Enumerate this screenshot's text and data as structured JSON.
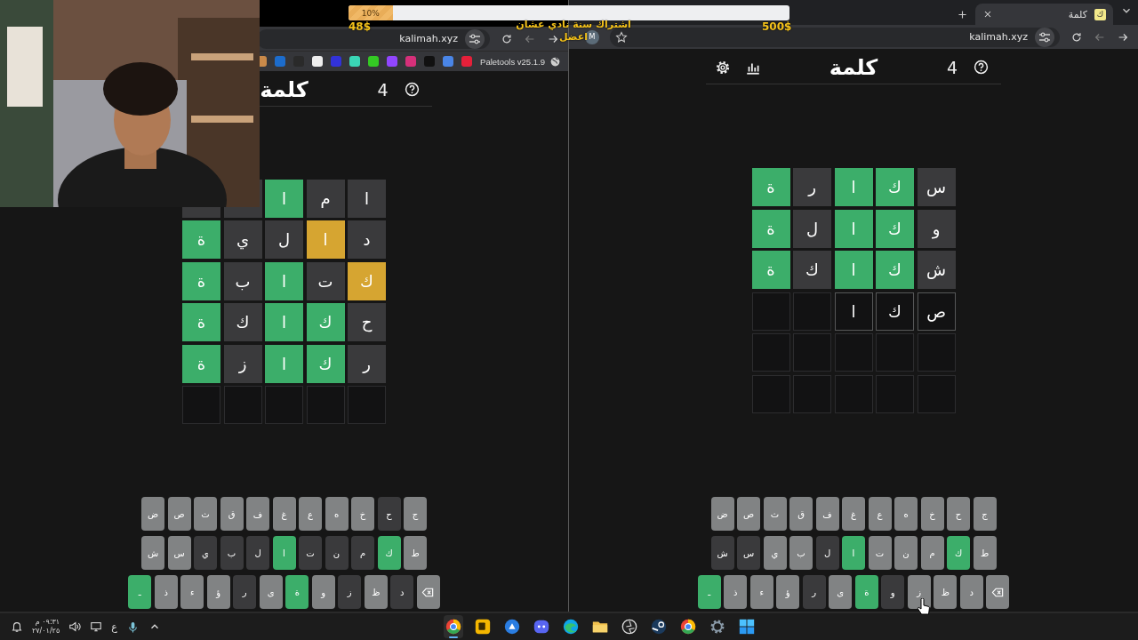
{
  "stream_goal": {
    "label": "10%",
    "level": 0.1,
    "raised": "48$",
    "target": "500$",
    "caption": [
      "اشتراك سنة نادي عشان",
      "اعضل"
    ]
  },
  "windows": [
    {
      "tab_strip": {
        "tabs": [
          {
            "title": "كلمة",
            "favicon": "ك",
            "selected": true
          }
        ]
      },
      "toolbar": {
        "url": "kalimah.xyz",
        "profile": "M",
        "nav": [
          {
            "kind": "forward",
            "disabled": false
          },
          {
            "kind": "back",
            "disabled": true
          },
          {
            "kind": "reload",
            "disabled": false
          }
        ]
      },
      "board": {
        "header": {
          "title": "كلمة",
          "count": "4",
          "tools": [
            {
              "kind": "stats"
            },
            {
              "kind": "settings"
            }
          ]
        },
        "rows": [
          [
            {
              "kind": "scored",
              "letter": "س",
              "color": "#3a3a3c"
            },
            {
              "kind": "scored",
              "letter": "ك",
              "color": "#3cae6a"
            },
            {
              "kind": "scored",
              "letter": "ا",
              "color": "#3cae6a"
            },
            {
              "kind": "scored",
              "letter": "ر",
              "color": "#3a3a3c"
            },
            {
              "kind": "scored",
              "letter": "ة",
              "color": "#3cae6a"
            }
          ],
          [
            {
              "kind": "scored",
              "letter": "و",
              "color": "#3a3a3c"
            },
            {
              "kind": "scored",
              "letter": "ك",
              "color": "#3cae6a"
            },
            {
              "kind": "scored",
              "letter": "ا",
              "color": "#3cae6a"
            },
            {
              "kind": "scored",
              "letter": "ل",
              "color": "#3a3a3c"
            },
            {
              "kind": "scored",
              "letter": "ة",
              "color": "#3cae6a"
            }
          ],
          [
            {
              "kind": "scored",
              "letter": "ش",
              "color": "#3a3a3c"
            },
            {
              "kind": "scored",
              "letter": "ك",
              "color": "#3cae6a"
            },
            {
              "kind": "scored",
              "letter": "ا",
              "color": "#3cae6a"
            },
            {
              "kind": "scored",
              "letter": "ك",
              "color": "#3a3a3c"
            },
            {
              "kind": "scored",
              "letter": "ة",
              "color": "#3cae6a"
            }
          ],
          [
            {
              "kind": "typed",
              "letter": "ص"
            },
            {
              "kind": "typed",
              "letter": "ك"
            },
            {
              "kind": "typed",
              "letter": "ا"
            },
            {
              "kind": "empty"
            },
            {
              "kind": "empty"
            }
          ],
          [
            {
              "kind": "empty"
            },
            {
              "kind": "empty"
            },
            {
              "kind": "empty"
            },
            {
              "kind": "empty"
            },
            {
              "kind": "empty"
            }
          ],
          [
            {
              "kind": "empty"
            },
            {
              "kind": "empty"
            },
            {
              "kind": "empty"
            },
            {
              "kind": "empty"
            },
            {
              "kind": "empty"
            }
          ]
        ],
        "keyboard": [
          [
            {
              "kind": "letter",
              "label": "ج",
              "color": "#818384"
            },
            {
              "kind": "letter",
              "label": "ح",
              "color": "#818384"
            },
            {
              "kind": "letter",
              "label": "خ",
              "color": "#818384"
            },
            {
              "kind": "letter",
              "label": "ه",
              "color": "#818384"
            },
            {
              "kind": "letter",
              "label": "ع",
              "color": "#818384"
            },
            {
              "kind": "letter",
              "label": "غ",
              "color": "#818384"
            },
            {
              "kind": "letter",
              "label": "ف",
              "color": "#818384"
            },
            {
              "kind": "letter",
              "label": "ق",
              "color": "#818384"
            },
            {
              "kind": "letter",
              "label": "ث",
              "color": "#818384"
            },
            {
              "kind": "letter",
              "label": "ص",
              "color": "#818384"
            },
            {
              "kind": "letter",
              "label": "ض",
              "color": "#818384"
            }
          ],
          [
            {
              "kind": "letter",
              "label": "ط",
              "color": "#818384"
            },
            {
              "kind": "letter",
              "label": "ك",
              "color": "#3cae6a"
            },
            {
              "kind": "letter",
              "label": "م",
              "color": "#818384"
            },
            {
              "kind": "letter",
              "label": "ن",
              "color": "#818384"
            },
            {
              "kind": "letter",
              "label": "ت",
              "color": "#818384"
            },
            {
              "kind": "letter",
              "label": "ا",
              "color": "#3cae6a"
            },
            {
              "kind": "letter",
              "label": "ل",
              "color": "#3a3a3c"
            },
            {
              "kind": "letter",
              "label": "ب",
              "color": "#818384"
            },
            {
              "kind": "letter",
              "label": "ي",
              "color": "#818384"
            },
            {
              "kind": "letter",
              "label": "س",
              "color": "#3a3a3c"
            },
            {
              "kind": "letter",
              "label": "ش",
              "color": "#3a3a3c"
            }
          ],
          [
            {
              "kind": "backspace",
              "color": "#818384"
            },
            {
              "kind": "letter",
              "label": "د",
              "color": "#818384"
            },
            {
              "kind": "letter",
              "label": "ظ",
              "color": "#818384"
            },
            {
              "kind": "letter",
              "label": "ز",
              "color": "#818384"
            },
            {
              "kind": "letter",
              "label": "و",
              "color": "#3a3a3c"
            },
            {
              "kind": "letter",
              "label": "ة",
              "color": "#3cae6a"
            },
            {
              "kind": "letter",
              "label": "ى",
              "color": "#818384"
            },
            {
              "kind": "letter",
              "label": "ر",
              "color": "#3a3a3c"
            },
            {
              "kind": "letter",
              "label": "ؤ",
              "color": "#818384"
            },
            {
              "kind": "letter",
              "label": "ء",
              "color": "#818384"
            },
            {
              "kind": "letter",
              "label": "ذ",
              "color": "#818384"
            },
            {
              "kind": "enter",
              "label": "ـ",
              "color": "#3cae6a"
            }
          ]
        ]
      }
    },
    {
      "toolbar": {
        "url": "kalimah.xyz",
        "nav": [
          {
            "kind": "forward",
            "disabled": false
          },
          {
            "kind": "back",
            "disabled": true
          },
          {
            "kind": "reload",
            "disabled": false
          }
        ]
      },
      "bookmarks": [
        {
          "kind": "globe",
          "label": "Paletools v25.1.9"
        },
        {
          "kind": "site",
          "color": "#e5203a"
        },
        {
          "kind": "site",
          "color": "#4a86e8"
        },
        {
          "kind": "site",
          "color": "#111111"
        },
        {
          "kind": "site",
          "color": "#d6307a"
        },
        {
          "kind": "site",
          "color": "#9146ff"
        },
        {
          "kind": "site",
          "color": "#34c924"
        },
        {
          "kind": "site",
          "color": "#3ad6b6"
        },
        {
          "kind": "site",
          "color": "#3232d8"
        },
        {
          "kind": "site",
          "color": "#eeeeee"
        },
        {
          "kind": "site",
          "color": "#2a2a2a"
        },
        {
          "kind": "site",
          "color": "#1c6ccc"
        },
        {
          "kind": "site",
          "color": "#c98a4a"
        }
      ],
      "board": {
        "header": {
          "title": "كلمة",
          "count": "4"
        },
        "rows": [
          [
            {
              "kind": "scored",
              "letter": "ا",
              "color": "#3a3a3c"
            },
            {
              "kind": "scored",
              "letter": "م",
              "color": "#3a3a3c"
            },
            {
              "kind": "scored",
              "letter": "ا",
              "color": "#3cae6a"
            },
            {
              "kind": "scored",
              "color": "#3a3a3c"
            },
            {
              "kind": "scored",
              "color": "#3a3a3c"
            }
          ],
          [
            {
              "kind": "scored",
              "letter": "د",
              "color": "#3a3a3c"
            },
            {
              "kind": "scored",
              "letter": "ا",
              "color": "#d6a531"
            },
            {
              "kind": "scored",
              "letter": "ل",
              "color": "#3a3a3c"
            },
            {
              "kind": "scored",
              "letter": "ي",
              "color": "#3a3a3c"
            },
            {
              "kind": "scored",
              "letter": "ة",
              "color": "#3cae6a"
            }
          ],
          [
            {
              "kind": "scored",
              "letter": "ك",
              "color": "#d6a531"
            },
            {
              "kind": "scored",
              "letter": "ت",
              "color": "#3a3a3c"
            },
            {
              "kind": "scored",
              "letter": "ا",
              "color": "#3cae6a"
            },
            {
              "kind": "scored",
              "letter": "ب",
              "color": "#3a3a3c"
            },
            {
              "kind": "scored",
              "letter": "ة",
              "color": "#3cae6a"
            }
          ],
          [
            {
              "kind": "scored",
              "letter": "ح",
              "color": "#3a3a3c"
            },
            {
              "kind": "scored",
              "letter": "ك",
              "color": "#3cae6a"
            },
            {
              "kind": "scored",
              "letter": "ا",
              "color": "#3cae6a"
            },
            {
              "kind": "scored",
              "letter": "ك",
              "color": "#3a3a3c"
            },
            {
              "kind": "scored",
              "letter": "ة",
              "color": "#3cae6a"
            }
          ],
          [
            {
              "kind": "scored",
              "letter": "ر",
              "color": "#3a3a3c"
            },
            {
              "kind": "scored",
              "letter": "ك",
              "color": "#3cae6a"
            },
            {
              "kind": "scored",
              "letter": "ا",
              "color": "#3cae6a"
            },
            {
              "kind": "scored",
              "letter": "ز",
              "color": "#3a3a3c"
            },
            {
              "kind": "scored",
              "letter": "ة",
              "color": "#3cae6a"
            }
          ],
          [
            {
              "kind": "empty"
            },
            {
              "kind": "empty"
            },
            {
              "kind": "empty"
            },
            {
              "kind": "empty"
            },
            {
              "kind": "empty"
            }
          ]
        ],
        "keyboard": [
          [
            {
              "kind": "letter",
              "label": "ج",
              "color": "#818384"
            },
            {
              "kind": "letter",
              "label": "ح",
              "color": "#3a3a3c"
            },
            {
              "kind": "letter",
              "label": "خ",
              "color": "#818384"
            },
            {
              "kind": "letter",
              "label": "ه",
              "color": "#818384"
            },
            {
              "kind": "letter",
              "label": "ع",
              "color": "#818384"
            },
            {
              "kind": "letter",
              "label": "غ",
              "color": "#818384"
            },
            {
              "kind": "letter",
              "label": "ف",
              "color": "#818384"
            },
            {
              "kind": "letter",
              "label": "ق",
              "color": "#818384"
            },
            {
              "kind": "letter",
              "label": "ث",
              "color": "#818384"
            },
            {
              "kind": "letter",
              "label": "ص",
              "color": "#818384"
            },
            {
              "kind": "letter",
              "label": "ض",
              "color": "#818384"
            }
          ],
          [
            {
              "kind": "letter",
              "label": "ط",
              "color": "#818384"
            },
            {
              "kind": "letter",
              "label": "ك",
              "color": "#3cae6a"
            },
            {
              "kind": "letter",
              "label": "م",
              "color": "#3a3a3c"
            },
            {
              "kind": "letter",
              "label": "ن",
              "color": "#3a3a3c"
            },
            {
              "kind": "letter",
              "label": "ت",
              "color": "#3a3a3c"
            },
            {
              "kind": "letter",
              "label": "ا",
              "color": "#3cae6a"
            },
            {
              "kind": "letter",
              "label": "ل",
              "color": "#3a3a3c"
            },
            {
              "kind": "letter",
              "label": "ب",
              "color": "#3a3a3c"
            },
            {
              "kind": "letter",
              "label": "ي",
              "color": "#3a3a3c"
            },
            {
              "kind": "letter",
              "label": "س",
              "color": "#818384"
            },
            {
              "kind": "letter",
              "label": "ش",
              "color": "#818384"
            }
          ],
          [
            {
              "kind": "backspace",
              "color": "#818384"
            },
            {
              "kind": "letter",
              "label": "د",
              "color": "#3a3a3c"
            },
            {
              "kind": "letter",
              "label": "ظ",
              "color": "#818384"
            },
            {
              "kind": "letter",
              "label": "ز",
              "color": "#3a3a3c"
            },
            {
              "kind": "letter",
              "label": "و",
              "color": "#818384"
            },
            {
              "kind": "letter",
              "label": "ة",
              "color": "#3cae6a"
            },
            {
              "kind": "letter",
              "label": "ى",
              "color": "#818384"
            },
            {
              "kind": "letter",
              "label": "ر",
              "color": "#3a3a3c"
            },
            {
              "kind": "letter",
              "label": "ؤ",
              "color": "#818384"
            },
            {
              "kind": "letter",
              "label": "ء",
              "color": "#818384"
            },
            {
              "kind": "letter",
              "label": "ذ",
              "color": "#818384"
            },
            {
              "kind": "enter",
              "label": "ـ",
              "color": "#3cae6a"
            }
          ]
        ]
      }
    }
  ],
  "taskbar": {
    "clock": {
      "time": "٠٩:٣١ م",
      "date": "٢٧/٠١/٢٥"
    },
    "language": "ع",
    "apps": [
      {
        "kind": "browser",
        "selected": true
      },
      {
        "kind": "tile",
        "selected": false
      },
      {
        "kind": "share",
        "selected": false
      },
      {
        "kind": "chat",
        "selected": false
      },
      {
        "kind": "wave",
        "selected": false
      },
      {
        "kind": "folder",
        "selected": false
      },
      {
        "kind": "aperture",
        "selected": false
      },
      {
        "kind": "steam",
        "selected": false
      },
      {
        "kind": "browser",
        "selected": false
      },
      {
        "kind": "gear",
        "selected": false
      },
      {
        "kind": "start",
        "selected": false
      }
    ]
  }
}
